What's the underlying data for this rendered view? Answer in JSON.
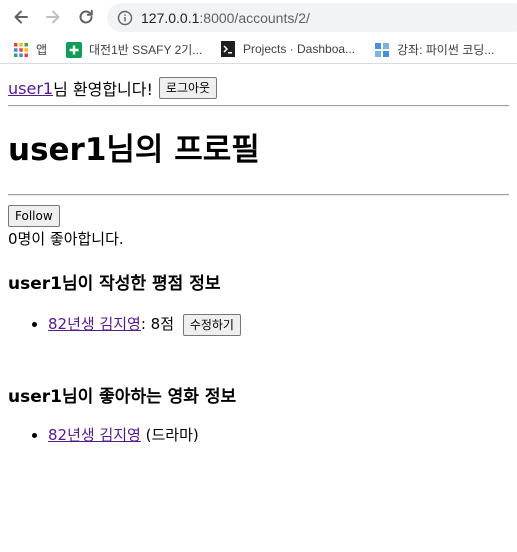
{
  "browser": {
    "url_host": "127.0.0.1",
    "url_path": ":8000/accounts/2/",
    "bookmarks": [
      {
        "label": "앱",
        "icon": "apps-grid-icon"
      },
      {
        "label": "대전1반 SSAFY 2기...",
        "icon": "green-plus-icon"
      },
      {
        "label": "Projects · Dashboa...",
        "icon": "terminal-icon"
      },
      {
        "label": "강좌: 파이썬 코딩...",
        "icon": "blue-blocks-icon"
      }
    ]
  },
  "header": {
    "username_link": "user1",
    "welcome_suffix": "님 환영합니다!",
    "logout_label": "로그아웃"
  },
  "profile": {
    "title": "user1님의 프로필",
    "follow_label": "Follow",
    "likes_text": "0명이 좋아합니다."
  },
  "ratings_section": {
    "heading": "user1님이 작성한 평점 정보",
    "items": [
      {
        "movie": "82년생 김지영",
        "score_text": ": 8점",
        "edit_label": "수정하기"
      }
    ]
  },
  "liked_section": {
    "heading": "user1님이 좋아하는 영화 정보",
    "items": [
      {
        "movie": "82년생 김지영",
        "genre_text": " (드라마)"
      }
    ]
  },
  "colors": {
    "visited_link": "#551a8b",
    "omnibox_bg": "#f1f3f4"
  }
}
